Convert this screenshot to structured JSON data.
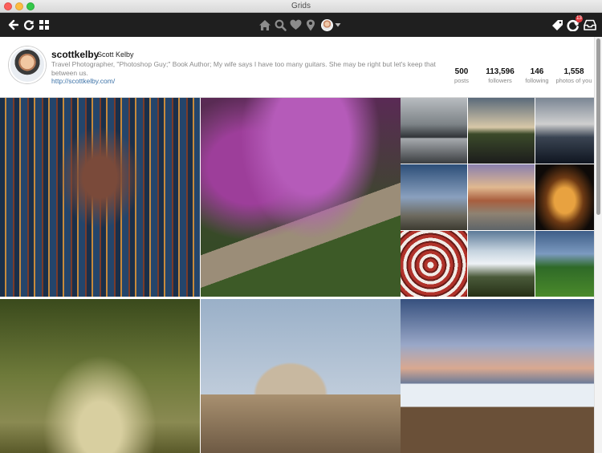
{
  "window": {
    "title": "Grids"
  },
  "toolbar": {
    "left_icons": [
      "back-arrow-icon",
      "refresh-icon",
      "grid-view-icon"
    ],
    "center_icons": [
      "home-icon",
      "search-icon",
      "heart-icon",
      "location-pin-icon"
    ],
    "right_icons": [
      "tag-icon",
      "activity-icon",
      "inbox-icon"
    ],
    "notification_count": "13"
  },
  "profile": {
    "username": "scottkelby",
    "full_name": "Scott Kelby",
    "bio": "Travel Photographer, \"Photoshop Guy;\" Book Author; My wife says I have too many guitars. She may be right but let's keep that between us.",
    "website": "http://scottkelby.com/",
    "stats": [
      {
        "value": "500",
        "label": "posts"
      },
      {
        "value": "113,596",
        "label": "followers"
      },
      {
        "value": "146",
        "label": "following"
      },
      {
        "value": "1,558",
        "label": "photos of you"
      }
    ]
  },
  "photos": [
    "cathedral-stained-glass",
    "flowered-garden-path",
    "long-exposure-waterfront",
    "empty-road",
    "gondolas",
    "lighthouse-coast",
    "canal-town",
    "parliament-night",
    "spiral-staircase",
    "waterfalls-rocks",
    "hillside-church",
    "tree-tunnel-road",
    "st-peters-basilica",
    "waterfall-sunset"
  ],
  "colors": {
    "toolbar_bg": "#1f1f1f",
    "link": "#3d73a8",
    "badge": "#e0393e"
  }
}
